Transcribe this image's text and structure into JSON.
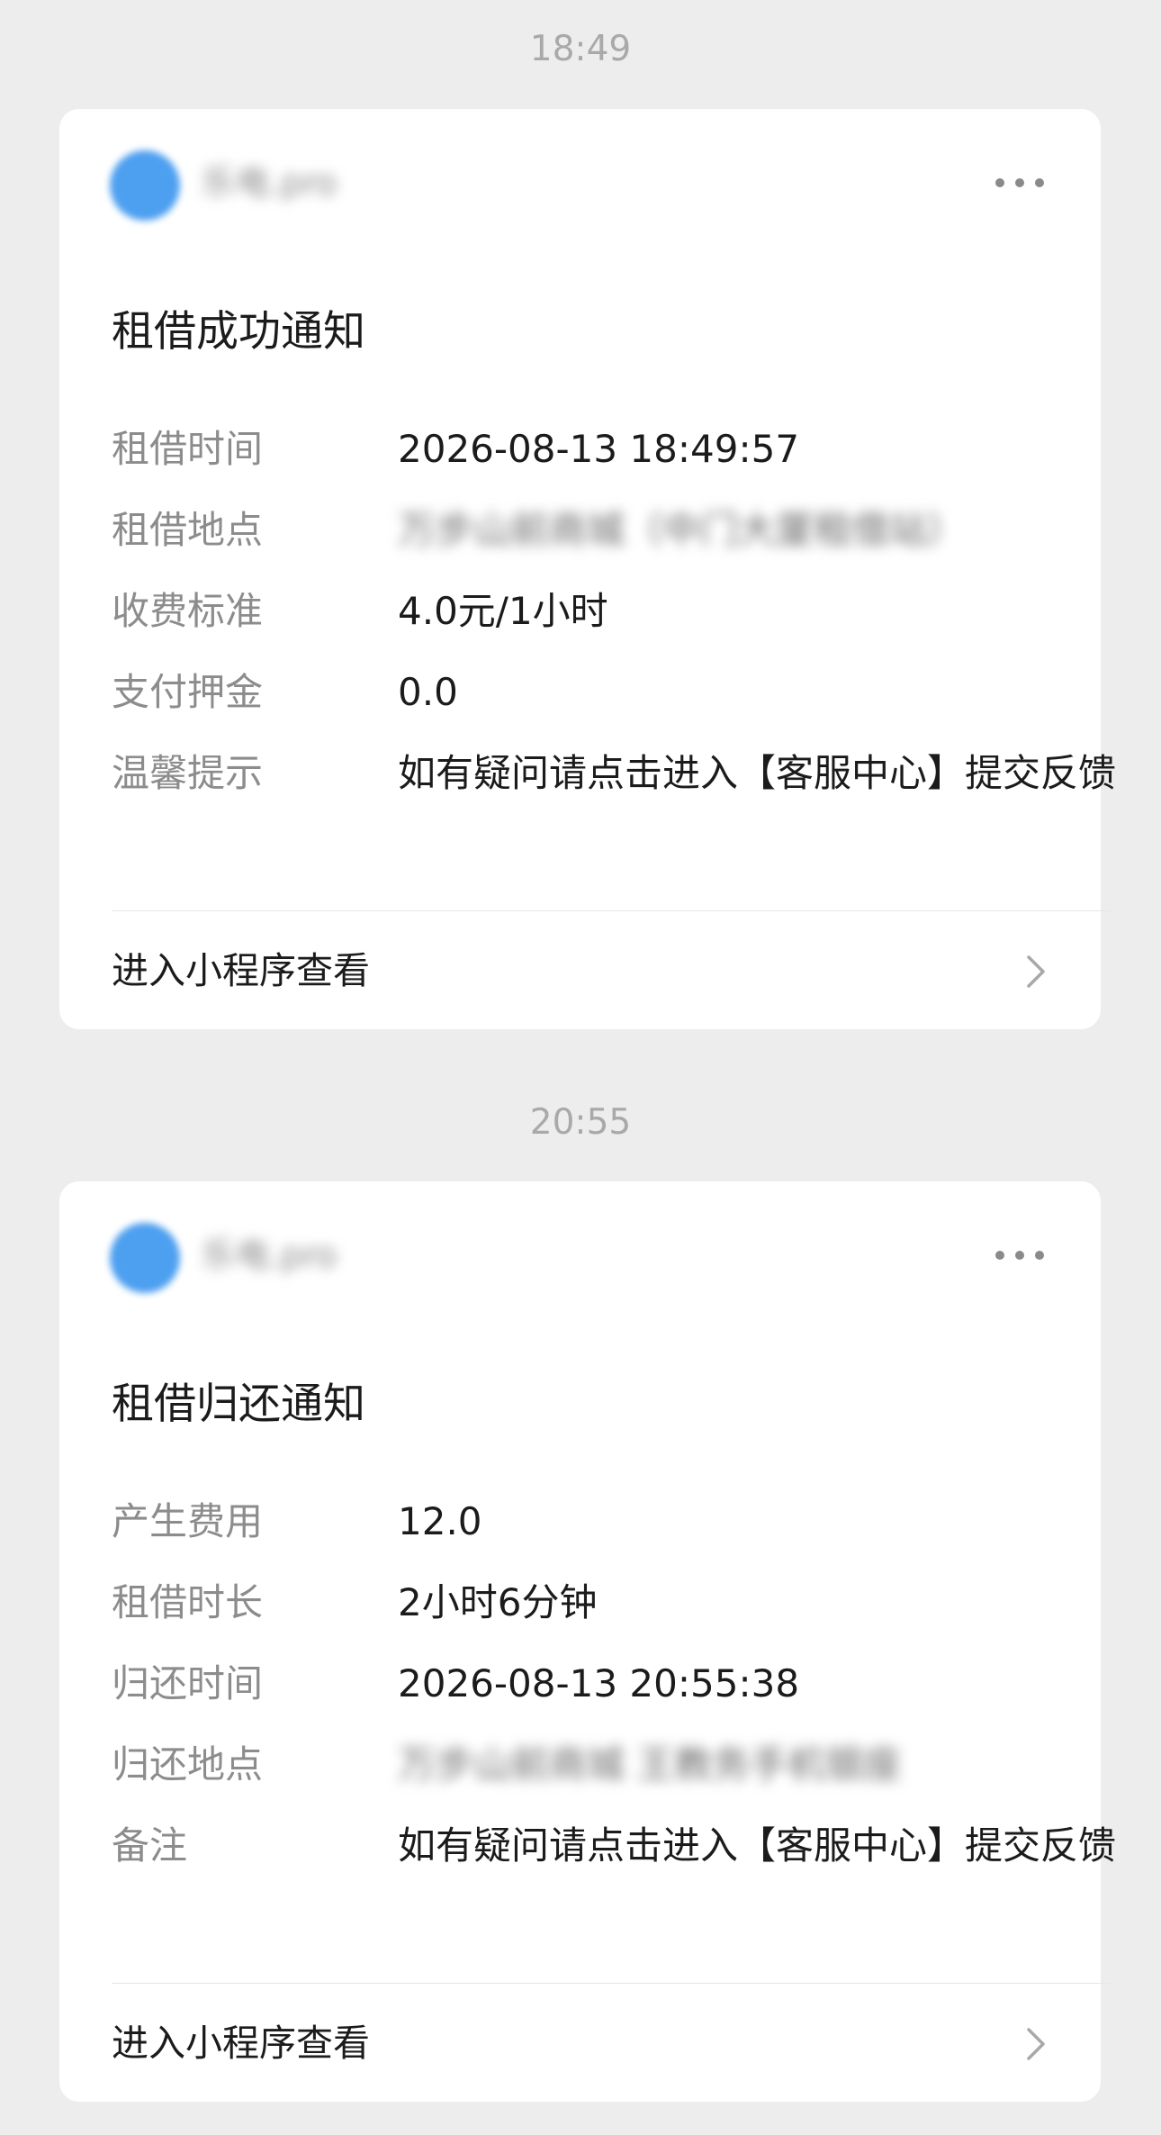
{
  "messages": [
    {
      "time": "18:49",
      "sender": "乐电.pro",
      "title": "租借成功通知",
      "fields": [
        {
          "label": "租借时间",
          "value": "2026-08-13 18:49:57"
        },
        {
          "label": "租借地点",
          "value": "万步山前商城（中门大厦租借站）"
        },
        {
          "label": "收费标准",
          "value": "4.0元/1小时"
        },
        {
          "label": "支付押金",
          "value": "0.0"
        },
        {
          "label": "温馨提示",
          "value": "如有疑问请点击进入【客服中心】提交反馈"
        }
      ],
      "link": "进入小程序查看"
    },
    {
      "time": "20:55",
      "sender": "乐电.pro",
      "title": "租借归还通知",
      "fields": [
        {
          "label": "产生费用",
          "value": "12.0"
        },
        {
          "label": "租借时长",
          "value": "2小时6分钟"
        },
        {
          "label": "归还时间",
          "value": "2026-08-13 20:55:38"
        },
        {
          "label": "归还地点",
          "value": "万步山前商城 王教务手机银座"
        },
        {
          "label": "备注",
          "value": "如有疑问请点击进入【客服中心】提交反馈"
        }
      ],
      "link": "进入小程序查看"
    }
  ],
  "icons": {
    "more": "more-dots-icon",
    "chevron": "chevron-right-icon",
    "avatar_color": "#4d9ff0"
  }
}
